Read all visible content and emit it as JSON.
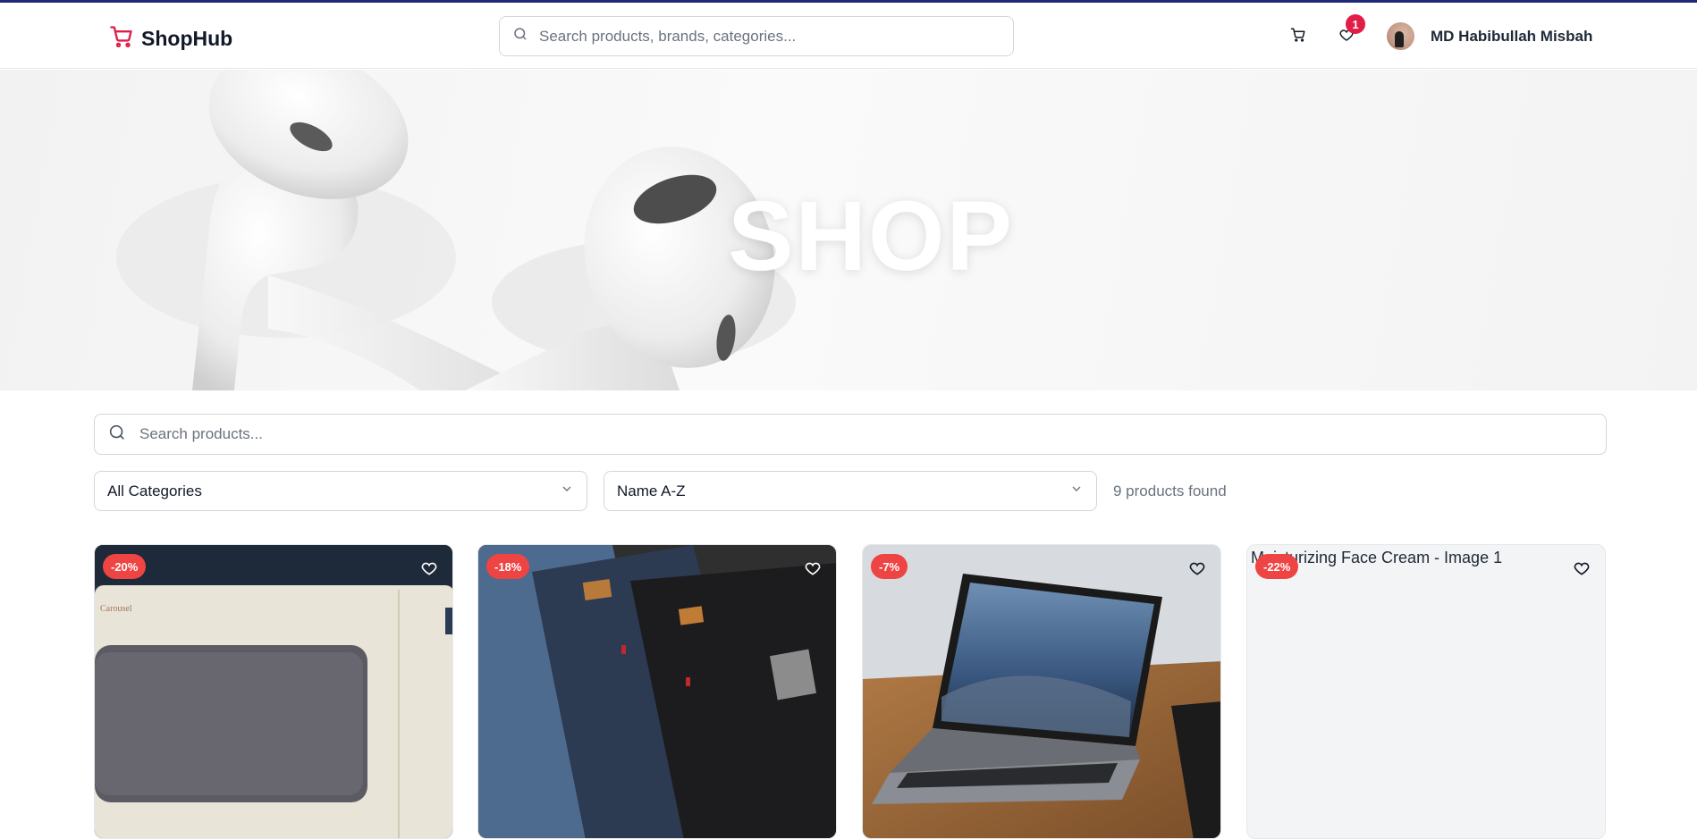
{
  "header": {
    "brand": "ShopHub",
    "search_placeholder": "Search products, brands, categories...",
    "wishlist_count": "1",
    "user_name": "MD Habibullah Misbah"
  },
  "hero": {
    "title": "SHOP"
  },
  "filters": {
    "search_placeholder": "Search products...",
    "category_selected": "All Categories",
    "sort_selected": "Name A-Z",
    "result_count": "9 products found"
  },
  "products": [
    {
      "discount": "-20%"
    },
    {
      "discount": "-18%"
    },
    {
      "discount": "-7%"
    },
    {
      "discount": "-22%",
      "image_alt": "Moisturizing Face Cream - Image 1"
    }
  ],
  "colors": {
    "brand": "#e11d48",
    "discount_badge": "#ef4444",
    "top_bar": "#1e2a78"
  }
}
